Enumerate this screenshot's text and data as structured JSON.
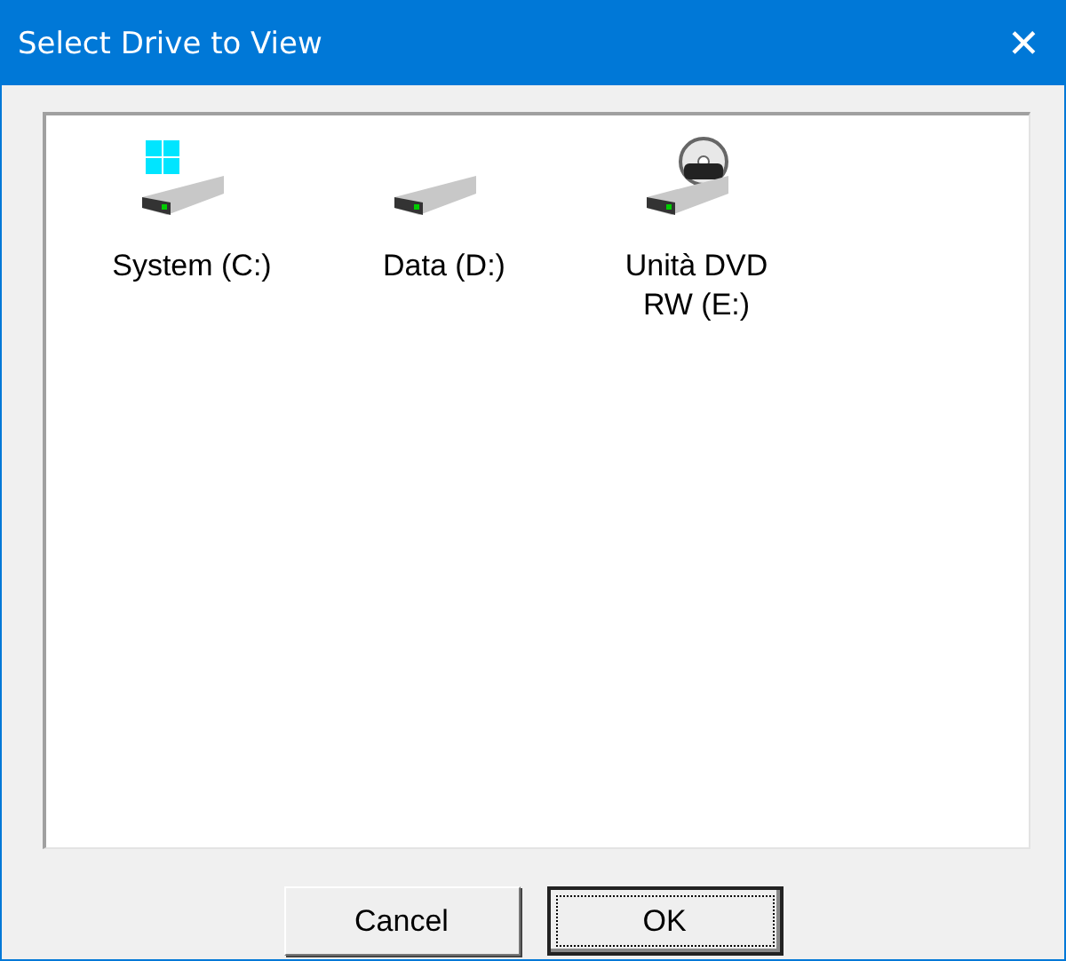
{
  "window": {
    "title": "Select Drive to View",
    "close": "✕"
  },
  "drives": [
    {
      "label": "System (C:)",
      "kind": "system"
    },
    {
      "label": "Data (D:)",
      "kind": "data"
    },
    {
      "label": "Unità DVD RW (E:)",
      "kind": "dvd"
    }
  ],
  "buttons": [
    {
      "label": "Cancel",
      "focused": false
    },
    {
      "label": "OK",
      "focused": true
    }
  ]
}
